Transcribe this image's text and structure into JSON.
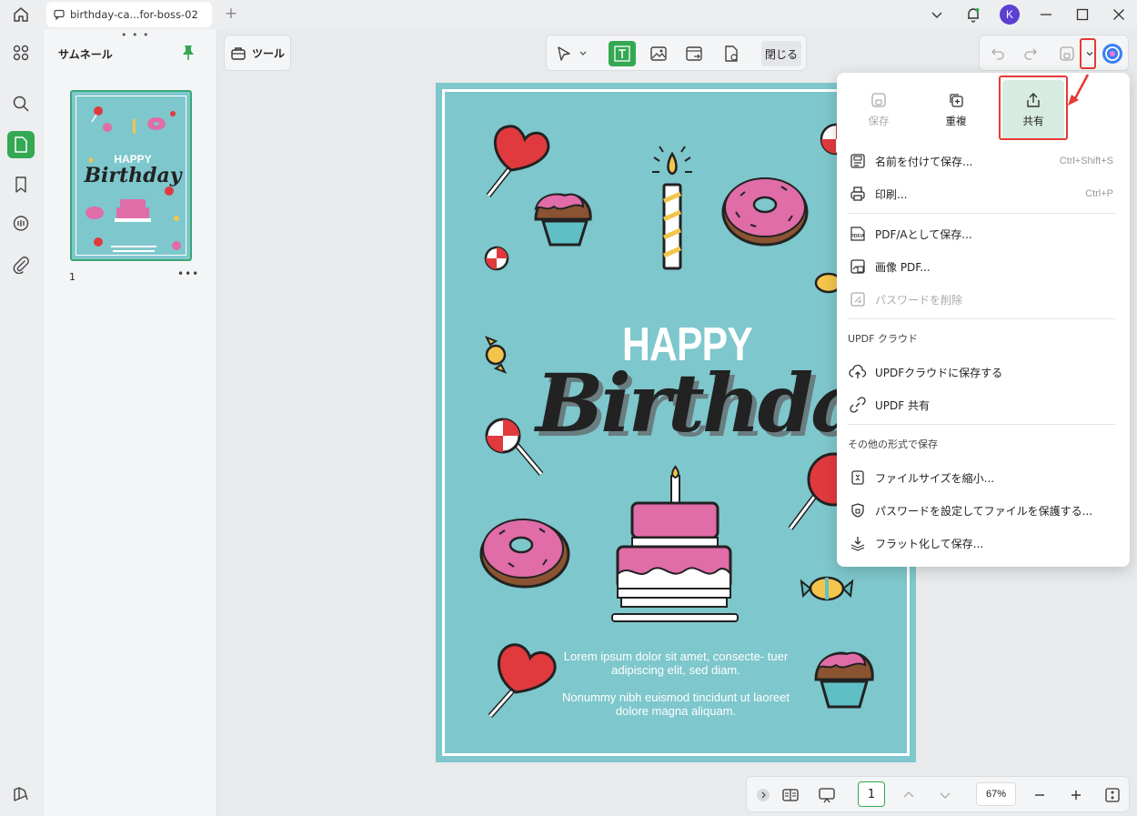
{
  "tab": {
    "title": "birthday-ca...for-boss-02"
  },
  "user": {
    "avatar_letter": "K"
  },
  "sidebar": {
    "thumbnails_title": "サムネール",
    "page_number": "1"
  },
  "toolbar": {
    "tools_label": "ツール",
    "close_label": "閉じる"
  },
  "document": {
    "happy": "HAPPY",
    "birthday": "Birthday",
    "lorem1": "Lorem ipsum dolor sit amet, consecte- tuer adipiscing elit, sed diam.",
    "lorem2": "Nonummy nibh euismod tincidunt ut laoreet dolore magna aliquam."
  },
  "menu": {
    "top": {
      "save": "保存",
      "duplicate": "重複",
      "share": "共有"
    },
    "save_as": "名前を付けて保存...",
    "save_as_shortcut": "Ctrl+Shift+S",
    "print": "印刷...",
    "print_shortcut": "Ctrl+P",
    "pdfa": "PDF/Aとして保存...",
    "image_pdf": "画像 PDF...",
    "remove_password": "パスワードを削除",
    "cloud_section": "UPDF クラウド",
    "save_cloud": "UPDFクラウドに保存する",
    "updf_share": "UPDF 共有",
    "other_section": "その他の形式で保存",
    "reduce_size": "ファイルサイズを縮小...",
    "protect_password": "パスワードを設定してファイルを保護する...",
    "flatten": "フラット化して保存..."
  },
  "bottom": {
    "page": "1",
    "zoom": "67%"
  },
  "colors": {
    "accent": "#34a853",
    "highlight": "#e53935",
    "doc_bg": "#7ec7cc",
    "avatar": "#5b3fd0"
  }
}
